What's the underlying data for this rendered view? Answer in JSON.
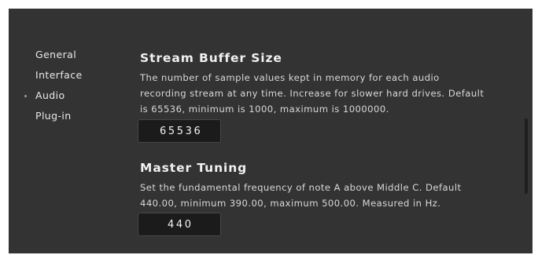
{
  "sidebar": {
    "items": [
      {
        "label": "General"
      },
      {
        "label": "Interface"
      },
      {
        "label": "Audio",
        "active": true
      },
      {
        "label": "Plug-in"
      }
    ]
  },
  "settings": {
    "stream_buffer": {
      "title": "Stream Buffer Size",
      "description": "The number of sample values kept in memory for each audio recording stream at any time. Increase for slower hard drives. Default is 65536, minimum is 1000, maximum is 1000000.",
      "value": "65536"
    },
    "master_tuning": {
      "title": "Master Tuning",
      "description": "Set the fundamental frequency of note A above Middle C. Default 440.00, minimum 390.00, maximum 500.00. Measured in Hz.",
      "value": "440"
    }
  },
  "colors": {
    "panel_background": "#333333",
    "input_background": "#1b1b1b",
    "text": "#e6e6e6"
  }
}
